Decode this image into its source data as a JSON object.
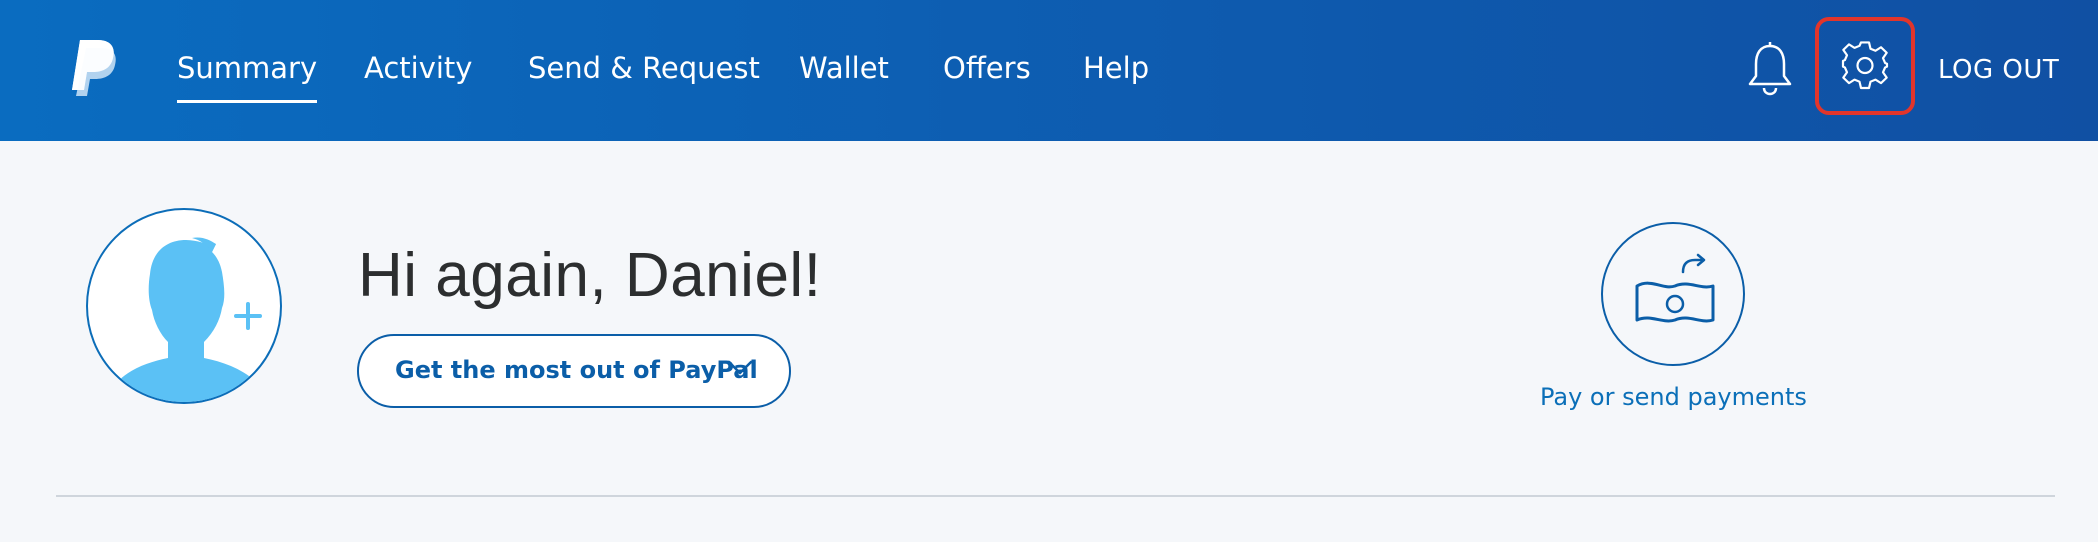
{
  "header": {
    "nav": [
      {
        "label": "Summary",
        "active": true
      },
      {
        "label": "Activity",
        "active": false
      },
      {
        "label": "Send & Request",
        "active": false
      },
      {
        "label": "Wallet",
        "active": false
      },
      {
        "label": "Offers",
        "active": false
      },
      {
        "label": "Help",
        "active": false
      }
    ],
    "notifications_icon": "bell-icon",
    "settings_icon": "gear-icon",
    "logout_label": "LOG OUT"
  },
  "main": {
    "greeting": "Hi again, Daniel!",
    "cta_button": "Get the most out of PayPal",
    "pay_action": {
      "label": "Pay or send payments",
      "icon": "money-send-icon"
    }
  },
  "colors": {
    "header_bg": "#0b62b6",
    "accent": "#0b5ea8",
    "highlight": "#e2352b",
    "avatar": "#5bc1f5"
  }
}
